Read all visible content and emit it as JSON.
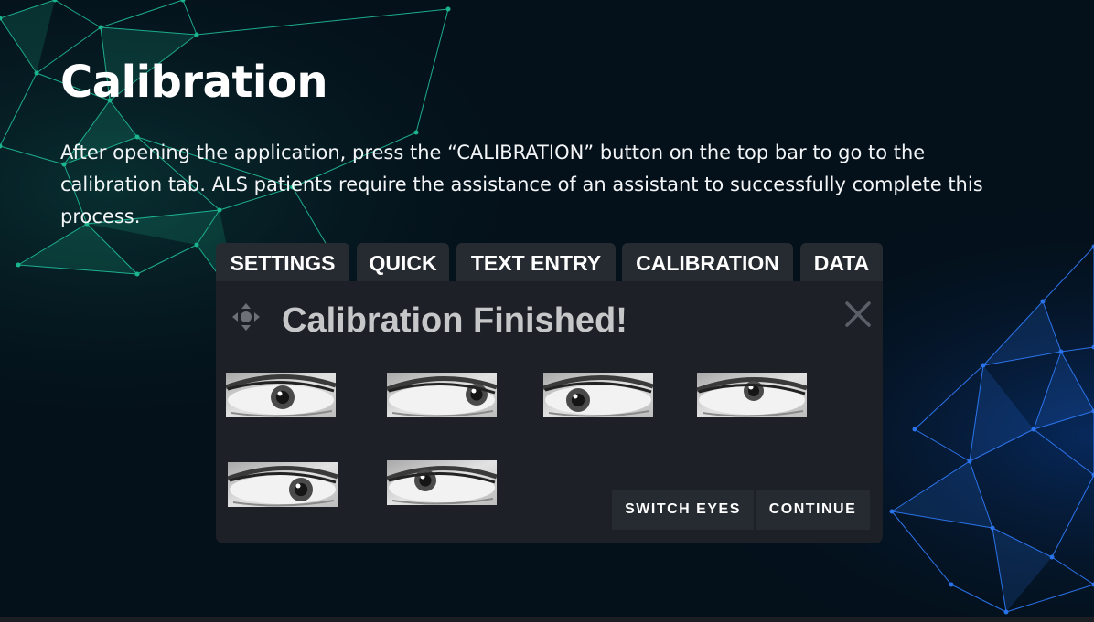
{
  "slide": {
    "title": "Calibration",
    "body": "After opening the application, press the “CALIBRATION” button on the top bar to go to the calibration tab. ALS patients require the assistance of an assistant to successfully complete this process."
  },
  "app": {
    "tabs": [
      {
        "label": "SETTINGS"
      },
      {
        "label": "QUICK"
      },
      {
        "label": "TEXT ENTRY"
      },
      {
        "label": "CALIBRATION"
      },
      {
        "label": "DATA"
      }
    ],
    "status_title": "Calibration Finished!",
    "eye_samples": [
      {
        "icon": "eye-sample-1"
      },
      {
        "icon": "eye-sample-2"
      },
      {
        "icon": "eye-sample-3"
      },
      {
        "icon": "eye-sample-4"
      },
      {
        "icon": "eye-sample-5"
      },
      {
        "icon": "eye-sample-6"
      }
    ],
    "buttons": {
      "switch_eyes": "SWITCH EYES",
      "continue": "CONTINUE"
    },
    "icons": {
      "move": "move-icon",
      "close": "close-icon"
    }
  },
  "colors": {
    "background": "#04101a",
    "network_green": "#1fd1a0",
    "network_blue": "#1f6bff",
    "panel": "#1d2127",
    "tab": "#262b31",
    "status_text": "#c6c7c9"
  }
}
